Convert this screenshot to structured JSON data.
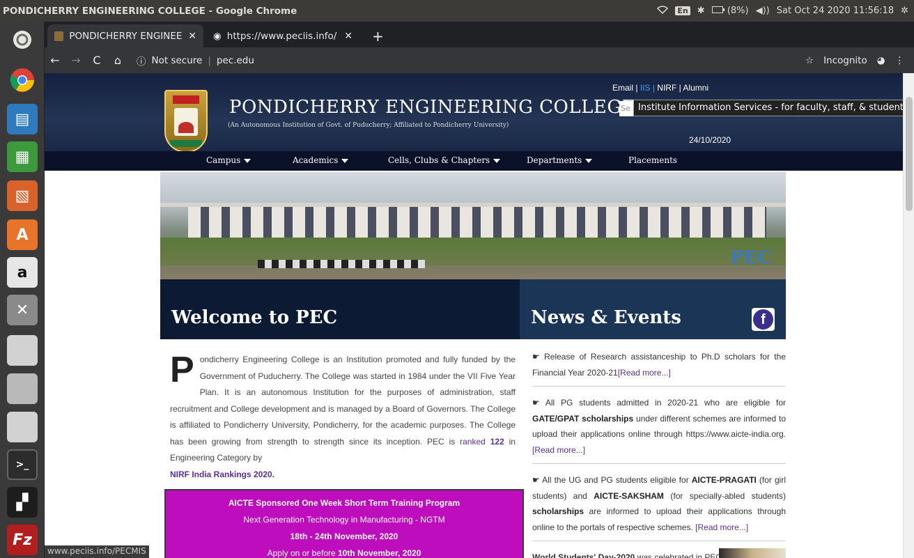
{
  "system": {
    "window_title": "PONDICHERRY ENGINEERING COLLEGE - Google Chrome",
    "keyboard_layout": "En",
    "battery": "(8%)",
    "clock": "Sat Oct 24 2020 11:56:18"
  },
  "launcher": {
    "items": [
      "ubuntu-logo-icon",
      "chrome-icon",
      "writer-icon",
      "calc-icon",
      "impress-icon",
      "software-center-icon",
      "amazon-icon",
      "system-settings-icon",
      "drive-icon",
      "files-icon",
      "drive-icon",
      "terminal-icon",
      "system-monitor-icon",
      "filezilla-icon"
    ]
  },
  "browser": {
    "tabs": [
      {
        "title": "PONDICHERRY ENGINEEF",
        "active": true
      },
      {
        "title": "https://www.peciis.info/",
        "active": false
      }
    ],
    "new_tab": "+",
    "security_label": "Not secure",
    "url": "pec.edu",
    "profile_label": "Incognito",
    "status_url": "www.peciis.info/PECMIS"
  },
  "site": {
    "title": "PONDICHERRY ENGINEERING COLLEGE",
    "subtitle": "(An Autonomous Institution of Govt. of Puducherry; Affiliated to Pondicherry University)",
    "top_links": {
      "email": "Email",
      "iis": "IIS",
      "nirf": "NIRF",
      "alumni": "Alumni"
    },
    "search_placeholder": "Se",
    "tooltip": "Institute Information Services - for faculty, staff, & students",
    "date": "24/10/2020",
    "nav": [
      "Campus",
      "Academics",
      "Cells, Clubs & Chapters",
      "Departments",
      "Placements"
    ],
    "banner_text": "PEC",
    "welcome_heading": "Welcome to PEC",
    "news_heading": "News & Events",
    "intro": {
      "dropcap": "P",
      "body": "ondicherry Engineering College is an Institution promoted and fully funded by the Government of Puducherry. The College was started in 1984 under the VII Five Year Plan. It is an autonomous Institution for the purposes of administration, staff recruitment and College development and is managed by a Board of Governors. The College is affiliated to Pondicherry University, Pondicherry, for the academic purposes. The College has been growing from strength to strength since its inception. PEC is",
      "ranked_word": "ranked",
      "rank": "122",
      "after_rank": "in Engineering Category by",
      "nirf_link": "NIRF India Rankings 2020."
    },
    "aicte_box": {
      "line1": "AICTE Sponsored One Week Short Term Training Program",
      "line2": "Next Generation Technology in Manufacturing - NGTM",
      "line3": "18th - 24th November, 2020",
      "line4_prefix": "Apply on or before",
      "line4_bold": "10th November, 2020"
    },
    "news": [
      {
        "text": "Release of Research assistanceship to Ph.D scholars for the Financial Year 2020-21",
        "link": "[Read more...]"
      },
      {
        "pre": "All PG students admitted in 2020-21 who are eligible for",
        "bold": "GATE/GPAT scholarships",
        "post": "under different schemes are informed to upload their applications online through https://www.aicte-india.org.",
        "link": "[Read more...]"
      },
      {
        "pre": "All the UG and PG students eligible for",
        "bold1": "AICTE-PRAGATI",
        "mid1": "(for girl students) and",
        "bold2": "AICTE-SAKSHAM",
        "mid2": "(for specially-abled students)",
        "bold3": "scholarships",
        "post": "are informed to upload their applications through online to the portals of respective schemes.",
        "link": "[Read more...]"
      },
      {
        "bold": "World Students' Day-2020",
        "post": "was celebrated in PEC"
      }
    ]
  }
}
